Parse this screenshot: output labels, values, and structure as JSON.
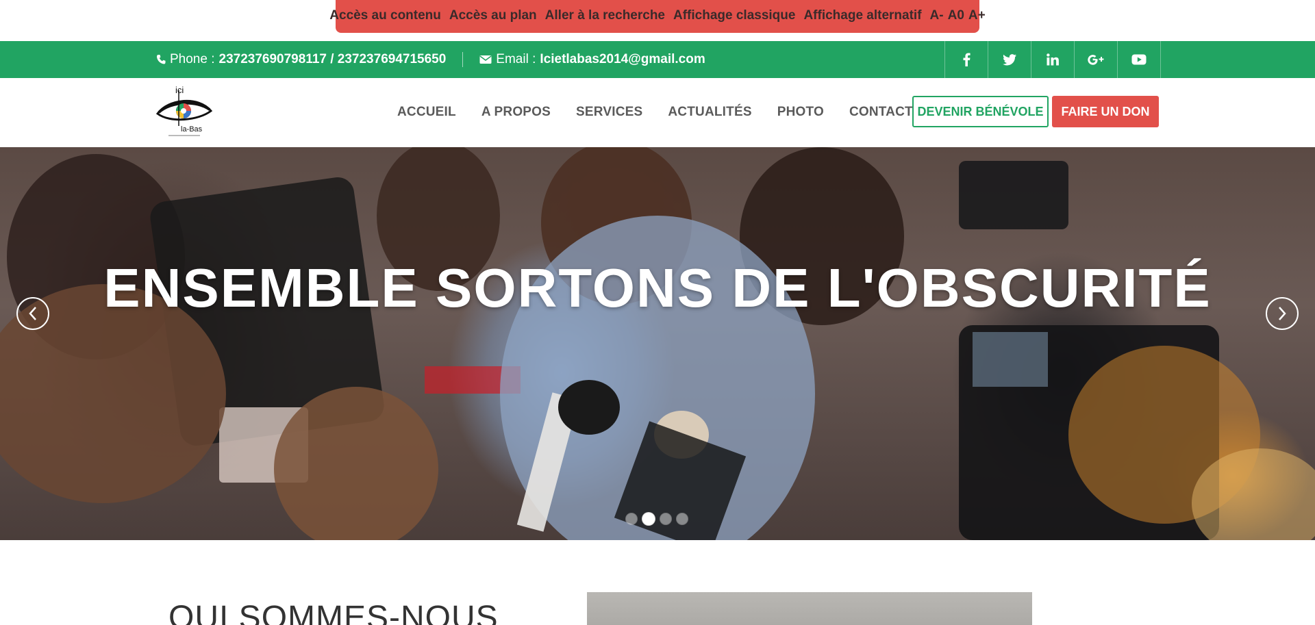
{
  "accessibility": {
    "links": [
      "Accès au contenu",
      "Accès au plan",
      "Aller à la recherche",
      "Affichage classique",
      "Affichage alternatif"
    ],
    "font_sizes": [
      "A-",
      "A0",
      "A+"
    ]
  },
  "topbar": {
    "phone_label": "Phone :",
    "phone_value": "237237690798117 / 237237694715650",
    "email_label": "Email :",
    "email_value": "Icietlabas2014@gmail.com",
    "social_icons": [
      "facebook-icon",
      "twitter-icon",
      "linkedin-icon",
      "google-plus-icon",
      "youtube-icon"
    ]
  },
  "header": {
    "logo_text_top": "ici",
    "logo_text_bottom": "la-Bas",
    "nav": [
      "ACCUEIL",
      "A PROPOS",
      "SERVICES",
      "ACTUALITÉS",
      "PHOTO",
      "CONTACT US"
    ],
    "volunteer_button": "DEVENIR BÉNÉVOLE",
    "donate_button": "FAIRE UN DON"
  },
  "hero": {
    "title": "ENSEMBLE SORTONS DE L'OBSCURITÉ",
    "slides_count": 4,
    "active_slide": 2
  },
  "about": {
    "title": "QUI SOMMES-NOUS"
  },
  "colors": {
    "accent_red": "#e2504a",
    "accent_green": "#21a462"
  }
}
